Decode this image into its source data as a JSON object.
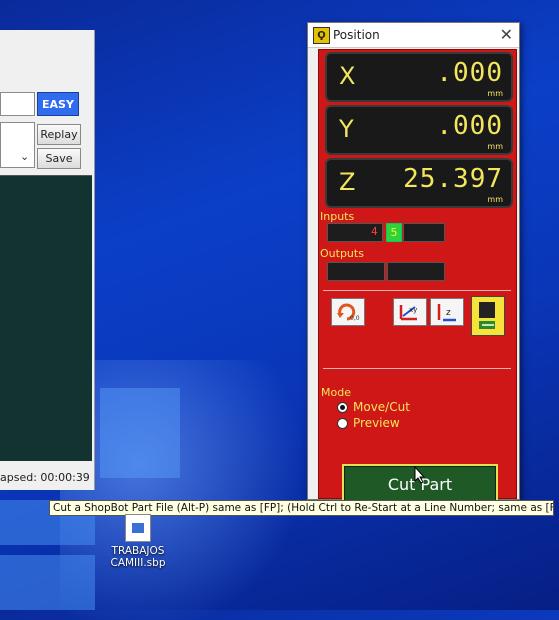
{
  "left_window": {
    "mode_button": "EASY",
    "replay_label": "Replay",
    "save_label": "Save",
    "elapsed_text": "apsed: 00:00:39"
  },
  "position_window": {
    "title": "Position",
    "axes": [
      {
        "axis": "X",
        "value": ".000",
        "unit": "mm"
      },
      {
        "axis": "Y",
        "value": ".000",
        "unit": "mm"
      },
      {
        "axis": "Z",
        "value": "25.397",
        "unit": "mm"
      }
    ],
    "inputs_label": "Inputs",
    "input_number": "4",
    "input_active": "5",
    "outputs_label": "Outputs",
    "mode_label": "Mode",
    "modes": [
      {
        "label": "Move/Cut",
        "selected": true
      },
      {
        "label": "Preview",
        "selected": false
      }
    ],
    "cut_part_label": "Cut Part",
    "colors": {
      "panel": "#d01717",
      "readout": "#f2e65c",
      "button": "#1f5a26"
    }
  },
  "tooltip": "Cut a ShopBot Part File (Alt-P) same as [FP]; (Hold Ctrl to Re-Start at a Line Number; same as [FG])",
  "desktop_icon": {
    "label_line1": "TRABAJOS",
    "label_line2": "CAMIII.sbp"
  }
}
